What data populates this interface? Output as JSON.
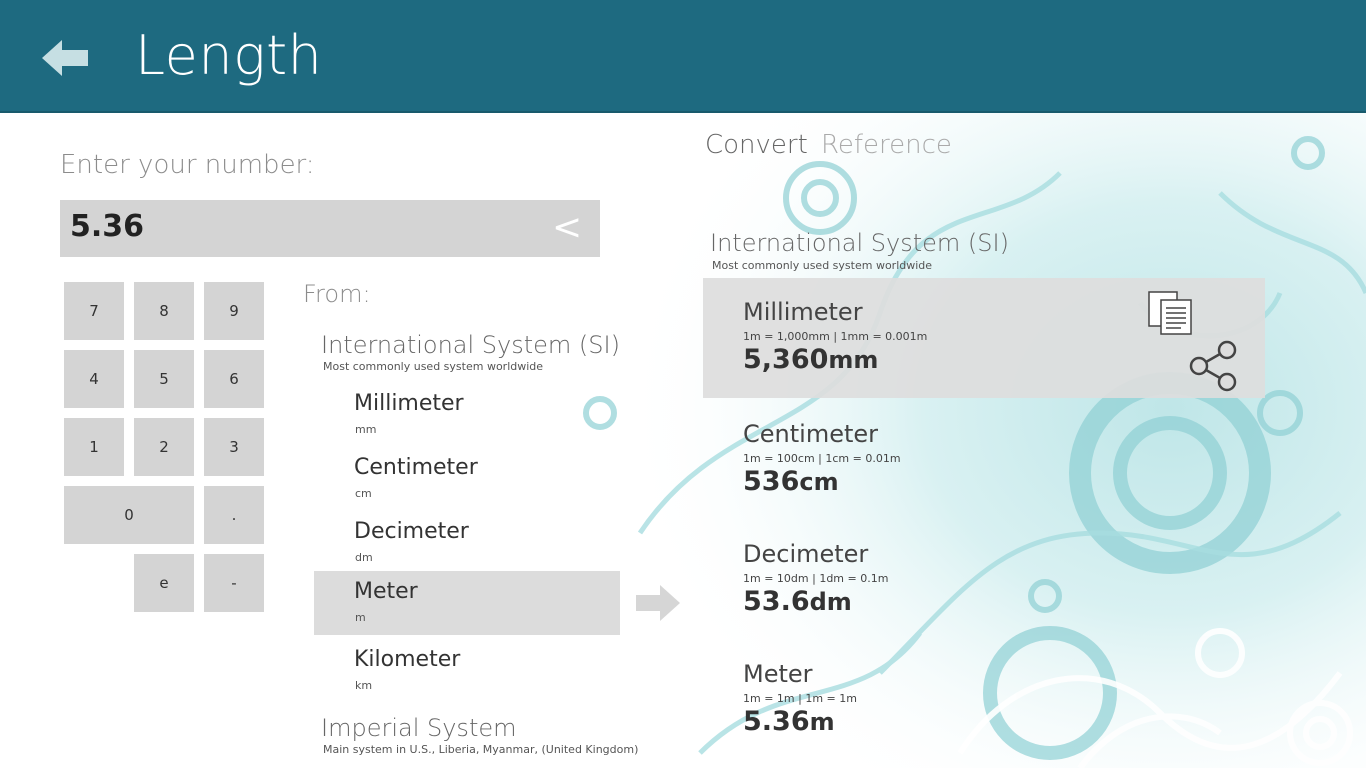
{
  "header": {
    "title": "Length",
    "back_icon": "back-arrow-icon"
  },
  "input": {
    "label": "Enter your number:",
    "value": "5.36",
    "backspace_label": "<"
  },
  "keypad": {
    "k7": "7",
    "k8": "8",
    "k9": "9",
    "k4": "4",
    "k5": "5",
    "k6": "6",
    "k1": "1",
    "k2": "2",
    "k3": "3",
    "k0": "0",
    "kdot": ".",
    "ke": "e",
    "kminus": "-"
  },
  "from": {
    "label": "From:",
    "groups": [
      {
        "title": "International System (SI)",
        "subtitle": "Most commonly used system worldwide",
        "units": [
          {
            "name": "Millimeter",
            "abbr": "mm"
          },
          {
            "name": "Centimeter",
            "abbr": "cm"
          },
          {
            "name": "Decimeter",
            "abbr": "dm"
          },
          {
            "name": "Meter",
            "abbr": "m"
          },
          {
            "name": "Kilometer",
            "abbr": "km"
          }
        ]
      },
      {
        "title": "Imperial System",
        "subtitle": "Main system in U.S., Liberia, Myanmar, (United Kingdom)"
      }
    ],
    "selected_unit": "Meter"
  },
  "tabs": [
    {
      "label": "Convert",
      "active": true
    },
    {
      "label": "Reference",
      "active": false
    }
  ],
  "results": {
    "group_title": "International System (SI)",
    "group_subtitle": "Most commonly used system worldwide",
    "items": [
      {
        "name": "Millimeter",
        "definition": "1m = 1,000mm  |  1mm = 0.001m",
        "value": "5,360",
        "unit": "mm"
      },
      {
        "name": "Centimeter",
        "definition": "1m = 100cm  |  1cm = 0.01m",
        "value": "536",
        "unit": "cm"
      },
      {
        "name": "Decimeter",
        "definition": "1m = 10dm  |  1dm = 0.1m",
        "value": "53.6",
        "unit": "dm"
      },
      {
        "name": "Meter",
        "definition": "1m = 1m  |  1m = 1m",
        "value": "5.36",
        "unit": "m"
      }
    ]
  },
  "colors": {
    "header_bg": "#1e6a80",
    "key_bg": "#d4d4d4",
    "selected_bg": "#dcdcdc",
    "decor": "#7fcbd0"
  }
}
